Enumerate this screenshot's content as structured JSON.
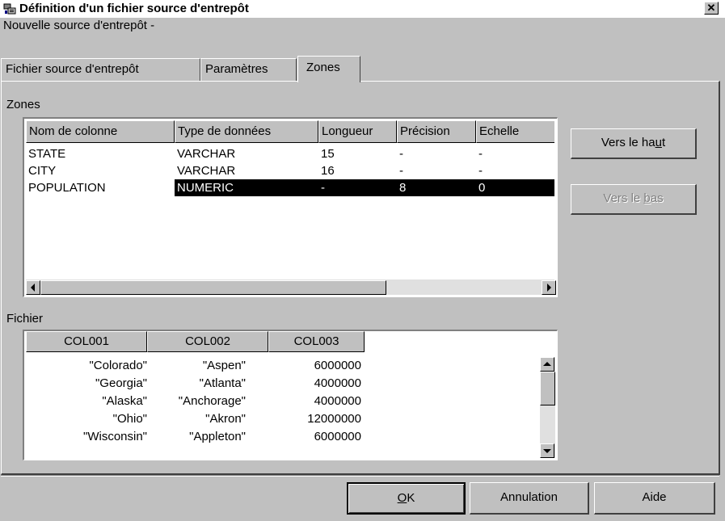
{
  "window": {
    "title": "Définition d'un fichier source d'entrepôt",
    "close_glyph": "✕",
    "subtitle": "Nouvelle source d'entrepôt -"
  },
  "tabs": [
    {
      "label": "Fichier source d'entrepôt",
      "active": false
    },
    {
      "label": "Paramètres",
      "active": false
    },
    {
      "label": "Zones",
      "active": true
    }
  ],
  "zones": {
    "label": "Zones",
    "columns": [
      "Nom de colonne",
      "Type de données",
      "Longueur",
      "Précision",
      "Echelle"
    ],
    "rows": [
      [
        "STATE",
        "VARCHAR",
        "15",
        "-",
        "-"
      ],
      [
        "CITY",
        "VARCHAR",
        "16",
        "-",
        "-"
      ],
      [
        "POPULATION",
        "NUMERIC",
        "-",
        "8",
        "0"
      ]
    ],
    "selected_row": 2
  },
  "side_buttons": {
    "up_before": "Vers le ha",
    "up_mnemonic": "u",
    "up_after": "t",
    "down_before": "Vers le ",
    "down_mnemonic": "b",
    "down_after": "as"
  },
  "fichier": {
    "label": "Fichier",
    "columns": [
      "COL001",
      "COL002",
      "COL003"
    ],
    "rows": [
      [
        "\"Colorado\"",
        "\"Aspen\"",
        "6000000"
      ],
      [
        "\"Georgia\"",
        "\"Atlanta\"",
        "4000000"
      ],
      [
        "\"Alaska\"",
        "\"Anchorage\"",
        "4000000"
      ],
      [
        "\"Ohio\"",
        "\"Akron\"",
        "12000000"
      ],
      [
        "\"Wisconsin\"",
        "\"Appleton\"",
        "6000000"
      ]
    ]
  },
  "buttons": {
    "ok_mnemonic": "O",
    "ok_rest": "K",
    "cancel": "Annulation",
    "help": "Aide"
  },
  "icons": [
    "app-icon",
    "close-icon",
    "scroll-left-icon",
    "scroll-right-icon",
    "scroll-up-icon",
    "scroll-down-icon"
  ]
}
